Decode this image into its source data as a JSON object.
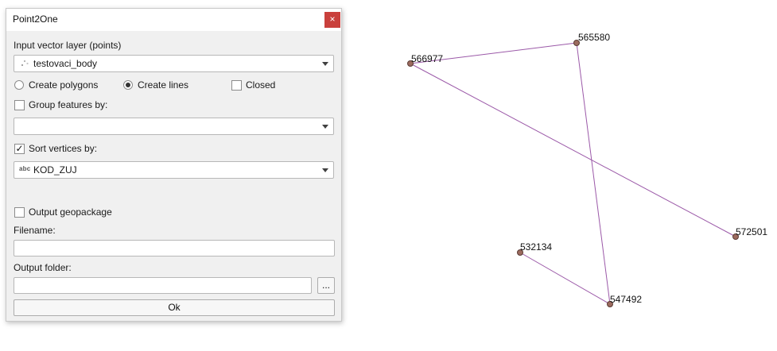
{
  "dialog": {
    "title": "Point2One",
    "close_glyph": "×",
    "input_layer_label": "Input vector layer (points)",
    "input_layer_value": "testovaci_body",
    "input_layer_icon": "point-layer-icon",
    "mode": {
      "create_polygons_label": "Create polygons",
      "create_polygons_selected": false,
      "create_lines_label": "Create lines",
      "create_lines_selected": true,
      "closed_label": "Closed",
      "closed_checked": false
    },
    "group_by": {
      "label": "Group features by:",
      "checked": false,
      "value": ""
    },
    "sort_by": {
      "label": "Sort vertices by:",
      "checked": true,
      "check_glyph": "✓",
      "field_type": "abc",
      "value": "KOD_ZUJ"
    },
    "output_geopackage": {
      "label": "Output geopackage",
      "checked": false
    },
    "filename": {
      "label": "Filename:",
      "value": ""
    },
    "output_folder": {
      "label": "Output folder:",
      "value": "",
      "browse_label": "..."
    },
    "ok_label": "Ok"
  },
  "map": {
    "line_color": "#9b59a8",
    "point_fill": "#9c6b5f",
    "point_stroke": "#5a3b34",
    "points": [
      {
        "id": "566977",
        "label": "566977"
      },
      {
        "id": "565580",
        "label": "565580"
      },
      {
        "id": "572501",
        "label": "572501"
      },
      {
        "id": "532134",
        "label": "532134"
      },
      {
        "id": "547492",
        "label": "547492"
      }
    ],
    "lines": [
      [
        "566977",
        "565580"
      ],
      [
        "566977",
        "572501"
      ],
      [
        "565580",
        "547492"
      ],
      [
        "532134",
        "547492"
      ]
    ]
  }
}
